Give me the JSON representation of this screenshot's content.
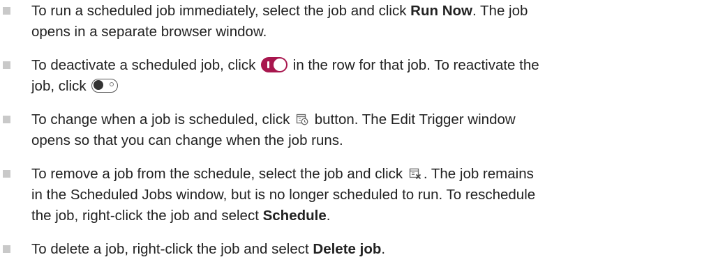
{
  "items": [
    {
      "t1": "To run a scheduled job immediately, select the job and click ",
      "b1": "Run Now",
      "t2": ". The job",
      "t3": "opens in a separate browser window."
    },
    {
      "t1": "To deactivate a scheduled job, click ",
      "t2": " in the row for that job. To reactivate the",
      "t3": "job, click "
    },
    {
      "t1": "To change when a job is scheduled, click ",
      "t2": " button. The Edit Trigger window",
      "t3": "opens so that you can change when the job runs."
    },
    {
      "t1": "To remove a job from the schedule, select the job and click ",
      "t2": ". The job remains",
      "t3": "in the Scheduled Jobs window, but is no longer scheduled to run. To reschedule",
      "t4": "the job, right-click the job and select ",
      "b1": "Schedule",
      "t5": "."
    },
    {
      "t1": "To delete a job, right-click the job and select ",
      "b1": "Delete job",
      "t2": "."
    }
  ],
  "icons": {
    "toggle_on": "toggle-on-icon",
    "toggle_off": "toggle-off-icon",
    "edit_trigger": "calendar-clock-icon",
    "unschedule": "calendar-remove-icon"
  },
  "colors": {
    "toggle_on": "#a8174e",
    "bullet": "#c9c9c9",
    "text": "#222222"
  }
}
